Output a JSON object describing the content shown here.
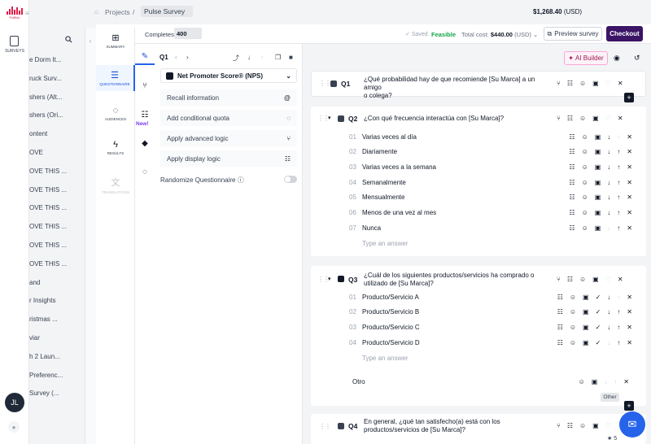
{
  "brand": {
    "logo_text": "Pollfish",
    "accent": "#3b1466"
  },
  "rail": {
    "surveys_label": "SURVEYS",
    "avatar_initials": "JL"
  },
  "survey_list": [
    "e Dorm It...",
    "ruck Surv...",
    "shers (Alt...",
    "shers (Ori...",
    "ontent",
    "OVE",
    "OVE THIS ...",
    "OVE THIS ...",
    "OVE THIS ...",
    "OVE THIS ...",
    "OVE THIS ...",
    "OVE THIS ...",
    "and",
    "r Insights",
    "ristmas ...",
    "viar",
    "h 2 Laun...",
    "Preferenc...",
    " Survey (..."
  ],
  "breadcrumb": {
    "projects": "Projects",
    "separator": "/",
    "current": "Pulse Survey"
  },
  "balance": {
    "amount": "$1,268.40",
    "currency": "(USD)"
  },
  "subbar": {
    "completes_label": "Completes:",
    "completes_value": "400",
    "saved": "Saved",
    "feasible": "Feasible",
    "total_cost_label": "Total cost:",
    "total_cost_value": "$440.00",
    "total_cost_currency": "(USD)",
    "preview": "Preview survey",
    "checkout": "Checkout"
  },
  "tools": [
    {
      "label": "SUMMARY",
      "icon": "summary-icon"
    },
    {
      "label": "QUESTIONNAIRE",
      "icon": "questionnaire-icon"
    },
    {
      "label": "AUDIENCES",
      "icon": "audiences-icon"
    },
    {
      "label": "RESULTS",
      "icon": "results-icon"
    },
    {
      "label": "TRANSLATIONS",
      "icon": "translations-icon"
    }
  ],
  "new_badge": "New!",
  "panel": {
    "q_label": "Q1",
    "question_type": "Net Promoter Score® (NPS)",
    "rows": [
      "Recall information",
      "Add conditional quota",
      "Apply advanced logic",
      "Apply display logic"
    ],
    "randomize": "Randomize Questionnaire"
  },
  "canvas": {
    "ai_builder": "AI Builder"
  },
  "questions": [
    {
      "num": "Q1",
      "text_line1": "¿Qué probabilidad hay de que recomiende [Su Marca] a un amigo",
      "text_line2": "o colega?"
    },
    {
      "num": "Q2",
      "text_line1": "¿Con qué frecuencia interactúa con [Su Marca]?",
      "text_line2": "",
      "options": [
        "Varias veces al día",
        "Diariamente",
        "Varias veces a la semana",
        "Semanalmente",
        "Mensualmente",
        "Menos de una vez al mes",
        "Nunca"
      ],
      "option_nums": [
        "01",
        "02",
        "03",
        "04",
        "05",
        "06",
        "07"
      ],
      "type_answer": "Type an answer"
    },
    {
      "num": "Q3",
      "text_line1": "¿Cuál de los siguientes productos/servicios ha comprado o",
      "text_line2": "utilizado de [Su Marca]?",
      "options": [
        "Producto/Servicio A",
        "Producto/Servicio B",
        "Producto/Servicio C",
        "Producto/Servicio D"
      ],
      "option_nums": [
        "01",
        "02",
        "03",
        "04"
      ],
      "type_answer": "Type an answer",
      "other": "Otro",
      "other_tip": "Other"
    },
    {
      "num": "Q4",
      "text_line1": "En general, ¿qué tan satisfecho(a) está con los",
      "text_line2": "productos/servicios de [Su Marca]?"
    }
  ],
  "rating": "5"
}
